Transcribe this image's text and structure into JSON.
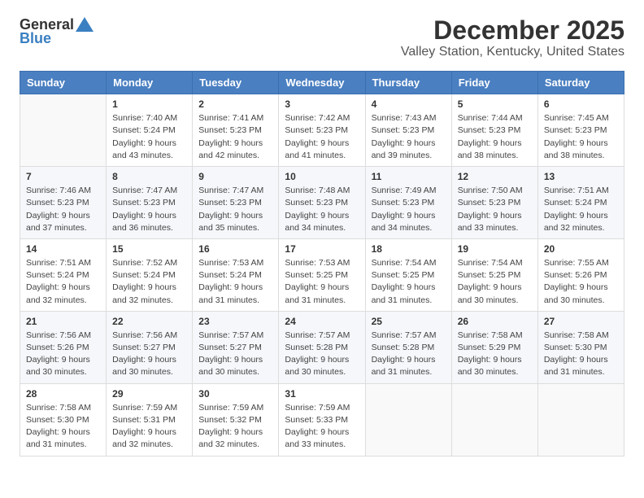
{
  "logo": {
    "general": "General",
    "blue": "Blue"
  },
  "header": {
    "month": "December 2025",
    "location": "Valley Station, Kentucky, United States"
  },
  "weekdays": [
    "Sunday",
    "Monday",
    "Tuesday",
    "Wednesday",
    "Thursday",
    "Friday",
    "Saturday"
  ],
  "weeks": [
    [
      {
        "day": "",
        "sunrise": "",
        "sunset": "",
        "daylight": ""
      },
      {
        "day": "1",
        "sunrise": "Sunrise: 7:40 AM",
        "sunset": "Sunset: 5:24 PM",
        "daylight": "Daylight: 9 hours and 43 minutes."
      },
      {
        "day": "2",
        "sunrise": "Sunrise: 7:41 AM",
        "sunset": "Sunset: 5:23 PM",
        "daylight": "Daylight: 9 hours and 42 minutes."
      },
      {
        "day": "3",
        "sunrise": "Sunrise: 7:42 AM",
        "sunset": "Sunset: 5:23 PM",
        "daylight": "Daylight: 9 hours and 41 minutes."
      },
      {
        "day": "4",
        "sunrise": "Sunrise: 7:43 AM",
        "sunset": "Sunset: 5:23 PM",
        "daylight": "Daylight: 9 hours and 39 minutes."
      },
      {
        "day": "5",
        "sunrise": "Sunrise: 7:44 AM",
        "sunset": "Sunset: 5:23 PM",
        "daylight": "Daylight: 9 hours and 38 minutes."
      },
      {
        "day": "6",
        "sunrise": "Sunrise: 7:45 AM",
        "sunset": "Sunset: 5:23 PM",
        "daylight": "Daylight: 9 hours and 38 minutes."
      }
    ],
    [
      {
        "day": "7",
        "sunrise": "Sunrise: 7:46 AM",
        "sunset": "Sunset: 5:23 PM",
        "daylight": "Daylight: 9 hours and 37 minutes."
      },
      {
        "day": "8",
        "sunrise": "Sunrise: 7:47 AM",
        "sunset": "Sunset: 5:23 PM",
        "daylight": "Daylight: 9 hours and 36 minutes."
      },
      {
        "day": "9",
        "sunrise": "Sunrise: 7:47 AM",
        "sunset": "Sunset: 5:23 PM",
        "daylight": "Daylight: 9 hours and 35 minutes."
      },
      {
        "day": "10",
        "sunrise": "Sunrise: 7:48 AM",
        "sunset": "Sunset: 5:23 PM",
        "daylight": "Daylight: 9 hours and 34 minutes."
      },
      {
        "day": "11",
        "sunrise": "Sunrise: 7:49 AM",
        "sunset": "Sunset: 5:23 PM",
        "daylight": "Daylight: 9 hours and 34 minutes."
      },
      {
        "day": "12",
        "sunrise": "Sunrise: 7:50 AM",
        "sunset": "Sunset: 5:23 PM",
        "daylight": "Daylight: 9 hours and 33 minutes."
      },
      {
        "day": "13",
        "sunrise": "Sunrise: 7:51 AM",
        "sunset": "Sunset: 5:24 PM",
        "daylight": "Daylight: 9 hours and 32 minutes."
      }
    ],
    [
      {
        "day": "14",
        "sunrise": "Sunrise: 7:51 AM",
        "sunset": "Sunset: 5:24 PM",
        "daylight": "Daylight: 9 hours and 32 minutes."
      },
      {
        "day": "15",
        "sunrise": "Sunrise: 7:52 AM",
        "sunset": "Sunset: 5:24 PM",
        "daylight": "Daylight: 9 hours and 32 minutes."
      },
      {
        "day": "16",
        "sunrise": "Sunrise: 7:53 AM",
        "sunset": "Sunset: 5:24 PM",
        "daylight": "Daylight: 9 hours and 31 minutes."
      },
      {
        "day": "17",
        "sunrise": "Sunrise: 7:53 AM",
        "sunset": "Sunset: 5:25 PM",
        "daylight": "Daylight: 9 hours and 31 minutes."
      },
      {
        "day": "18",
        "sunrise": "Sunrise: 7:54 AM",
        "sunset": "Sunset: 5:25 PM",
        "daylight": "Daylight: 9 hours and 31 minutes."
      },
      {
        "day": "19",
        "sunrise": "Sunrise: 7:54 AM",
        "sunset": "Sunset: 5:25 PM",
        "daylight": "Daylight: 9 hours and 30 minutes."
      },
      {
        "day": "20",
        "sunrise": "Sunrise: 7:55 AM",
        "sunset": "Sunset: 5:26 PM",
        "daylight": "Daylight: 9 hours and 30 minutes."
      }
    ],
    [
      {
        "day": "21",
        "sunrise": "Sunrise: 7:56 AM",
        "sunset": "Sunset: 5:26 PM",
        "daylight": "Daylight: 9 hours and 30 minutes."
      },
      {
        "day": "22",
        "sunrise": "Sunrise: 7:56 AM",
        "sunset": "Sunset: 5:27 PM",
        "daylight": "Daylight: 9 hours and 30 minutes."
      },
      {
        "day": "23",
        "sunrise": "Sunrise: 7:57 AM",
        "sunset": "Sunset: 5:27 PM",
        "daylight": "Daylight: 9 hours and 30 minutes."
      },
      {
        "day": "24",
        "sunrise": "Sunrise: 7:57 AM",
        "sunset": "Sunset: 5:28 PM",
        "daylight": "Daylight: 9 hours and 30 minutes."
      },
      {
        "day": "25",
        "sunrise": "Sunrise: 7:57 AM",
        "sunset": "Sunset: 5:28 PM",
        "daylight": "Daylight: 9 hours and 31 minutes."
      },
      {
        "day": "26",
        "sunrise": "Sunrise: 7:58 AM",
        "sunset": "Sunset: 5:29 PM",
        "daylight": "Daylight: 9 hours and 30 minutes."
      },
      {
        "day": "27",
        "sunrise": "Sunrise: 7:58 AM",
        "sunset": "Sunset: 5:30 PM",
        "daylight": "Daylight: 9 hours and 31 minutes."
      }
    ],
    [
      {
        "day": "28",
        "sunrise": "Sunrise: 7:58 AM",
        "sunset": "Sunset: 5:30 PM",
        "daylight": "Daylight: 9 hours and 31 minutes."
      },
      {
        "day": "29",
        "sunrise": "Sunrise: 7:59 AM",
        "sunset": "Sunset: 5:31 PM",
        "daylight": "Daylight: 9 hours and 32 minutes."
      },
      {
        "day": "30",
        "sunrise": "Sunrise: 7:59 AM",
        "sunset": "Sunset: 5:32 PM",
        "daylight": "Daylight: 9 hours and 32 minutes."
      },
      {
        "day": "31",
        "sunrise": "Sunrise: 7:59 AM",
        "sunset": "Sunset: 5:33 PM",
        "daylight": "Daylight: 9 hours and 33 minutes."
      },
      {
        "day": "",
        "sunrise": "",
        "sunset": "",
        "daylight": ""
      },
      {
        "day": "",
        "sunrise": "",
        "sunset": "",
        "daylight": ""
      },
      {
        "day": "",
        "sunrise": "",
        "sunset": "",
        "daylight": ""
      }
    ]
  ]
}
